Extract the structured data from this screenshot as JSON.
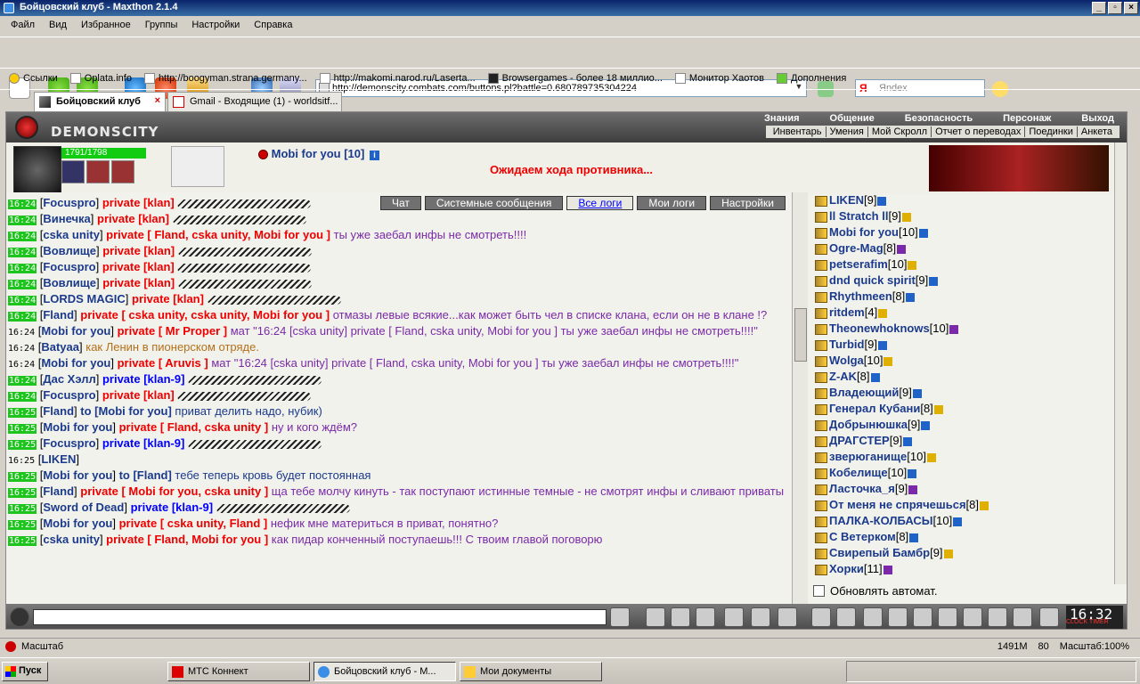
{
  "window": {
    "title": "Бойцовский клуб - Maxthon 2.1.4"
  },
  "menu": [
    "Файл",
    "Вид",
    "Избранное",
    "Группы",
    "Настройки",
    "Справка"
  ],
  "address": "http://demonscity.combats.com/buttons.pl?battle=0.680789735304224",
  "search_placeholder": "Яndex",
  "bookmarks": [
    "Ссылки",
    "Oplata.info",
    "http://boogyman.strana.germany...",
    "http://makomi.narod.ru/Laserta...",
    "Browsergames - более 18 миллио...",
    "Монитор Хаотов",
    "Дополнения"
  ],
  "tabs": [
    {
      "label": "Бойцовский клуб"
    },
    {
      "label": "Gmail - Входящие (1) - worldsitf..."
    }
  ],
  "game": {
    "logo": "DEMONSCITY",
    "topnav": [
      "Знания",
      "Общение",
      "Безопасность",
      "Персонаж",
      "Выход"
    ],
    "subnav": [
      "Инвентарь",
      "Умения",
      "Мой Скролл",
      "Отчет о переводах",
      "Поединки",
      "Анкета"
    ],
    "hp": "1791/1798",
    "hp_fraction": 0.996,
    "player": "Mobi for you [10]",
    "status": "Ожидаем хода противника...",
    "chat_tabs": [
      "Чат",
      "Системные сообщения",
      "Все логи",
      "Мои логи",
      "Настройки"
    ],
    "auto_refresh": "Обновлять автомат.",
    "clock": "16:32",
    "clock_labels": "CLOCK TIMER"
  },
  "chat": [
    {
      "time": "16:24",
      "nick": "Focuspro",
      "to": "private [klan]",
      "text": ""
    },
    {
      "time": "16:24",
      "nick": "Винечка",
      "to": "private [klan]",
      "text": ""
    },
    {
      "time": "16:24",
      "nick": "cska unity",
      "to": "private [ Fland, cska unity, Mobi for you ]",
      "text": "ты уже заебал инфы не смотреть!!!!"
    },
    {
      "time": "16:24",
      "nick": "Вовлище",
      "to": "private [klan]",
      "text": ""
    },
    {
      "time": "16:24",
      "nick": "Focuspro",
      "to": "private [klan]",
      "text": ""
    },
    {
      "time": "16:24",
      "nick": "Вовлище",
      "to": "private [klan]",
      "text": ""
    },
    {
      "time": "16:24",
      "nick": "LORDS MAGIC",
      "to": "private [klan]",
      "text": ""
    },
    {
      "time": "16:24",
      "nick": "Fland",
      "to": "private [ cska unity, cska unity, Mobi for you ]",
      "text": "отмазы левые всякие...как может быть чел в списке клана, если он не в клане !?"
    },
    {
      "time": "16:24",
      "nick": "Mobi for you",
      "to": "private [ Mr Proper ]",
      "text": "мат \"16:24 [cska unity] private [ Fland, cska unity, Mobi for you ] ты уже заебал инфы не смотреть!!!!\""
    },
    {
      "time": "16:24",
      "nick": "Batyaa",
      "to": "",
      "text": "как Ленин в пионерском отряде."
    },
    {
      "time": "16:24",
      "nick": "Mobi for you",
      "to": "private [ Aruvis ]",
      "text": "мат \"16:24 [cska unity] private [ Fland, cska unity, Mobi for you ] ты уже заебал инфы не смотреть!!!!\""
    },
    {
      "time": "16:24",
      "nick": "Дас Хэлл",
      "to": "private [klan-9]",
      "text": ""
    },
    {
      "time": "16:24",
      "nick": "Focuspro",
      "to": "private [klan]",
      "text": ""
    },
    {
      "time": "16:25",
      "nick": "Fland",
      "to": "to [Mobi for you]",
      "text": "приват делить надо, нубик)"
    },
    {
      "time": "16:25",
      "nick": "Mobi for you",
      "to": "private [ Fland, cska unity ]",
      "text": "ну и кого ждём?"
    },
    {
      "time": "16:25",
      "nick": "Focuspro",
      "to": "private [klan-9]",
      "text": ""
    },
    {
      "time": "16:25",
      "nick": "LIKEN",
      "to": "",
      "text": ""
    },
    {
      "time": "16:25",
      "nick": "Mobi for you",
      "to": "to [Fland]",
      "text": "тебе теперь кровь будет постоянная"
    },
    {
      "time": "16:25",
      "nick": "Fland",
      "to": "private [ Mobi for you, cska unity ]",
      "text": "ща тебе молчу кинуть - так поступают истинные темные - не смотрят инфы и сливают приваты"
    },
    {
      "time": "16:25",
      "nick": "Sword of Dead",
      "to": "private [klan-9]",
      "text": ""
    },
    {
      "time": "16:25",
      "nick": "Mobi for you",
      "to": "private [ cska unity, Fland ]",
      "text": "нефик мне материться в приват, понятно?"
    },
    {
      "time": "16:25",
      "nick": "cska unity",
      "to": "private [ Fland, Mobi for you ]",
      "text": "как пидар конченный поступаешь!!! С твоим главой поговорю"
    }
  ],
  "users": [
    {
      "name": "LIKEN",
      "level": "[9]"
    },
    {
      "name": "ll Stratch ll",
      "level": "[9]"
    },
    {
      "name": "Mobi for you",
      "level": "[10]"
    },
    {
      "name": "Ogre-Mag",
      "level": "[8]"
    },
    {
      "name": "petserafim",
      "level": "[10]"
    },
    {
      "name": "dnd quick spirit",
      "level": "[9]"
    },
    {
      "name": "Rhythmeen",
      "level": "[8]"
    },
    {
      "name": "ritdem",
      "level": "[4]"
    },
    {
      "name": "Theonewhoknows",
      "level": "[10]"
    },
    {
      "name": "Turbid",
      "level": "[9]"
    },
    {
      "name": "Wolga",
      "level": "[10]"
    },
    {
      "name": "Z-AK",
      "level": "[8]"
    },
    {
      "name": "Владеющий",
      "level": "[9]"
    },
    {
      "name": "Генерал Кубани",
      "level": "[8]"
    },
    {
      "name": "Добрынюшка",
      "level": "[9]"
    },
    {
      "name": "ДРАГСТЕР",
      "level": "[9]"
    },
    {
      "name": "зверюганище",
      "level": "[10]"
    },
    {
      "name": "Кобелище",
      "level": "[10]"
    },
    {
      "name": "Ласточка_я",
      "level": "[9]"
    },
    {
      "name": "От меня не спрячешься",
      "level": "[8]"
    },
    {
      "name": "ПАЛКА-КОЛБАСЫ",
      "level": "[10]"
    },
    {
      "name": "С Ветерком",
      "level": "[8]"
    },
    {
      "name": "Свирепый Бамбр",
      "level": "[9]"
    },
    {
      "name": "Хорки",
      "level": "[11]"
    }
  ],
  "status": {
    "left": "Масштаб",
    "memory": "1491M",
    "zoom": "Масштаб:100%",
    "count": "80"
  },
  "taskbar": {
    "start": "Пуск",
    "items": [
      "МТС Коннект",
      "Бойцовский клуб - M...",
      "Мои документы"
    ]
  }
}
